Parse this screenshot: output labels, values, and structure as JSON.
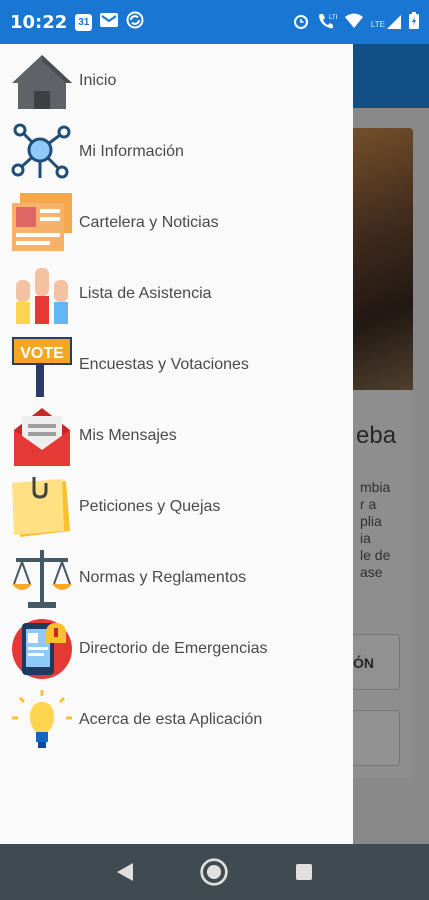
{
  "status_bar": {
    "time": "10:22",
    "left_icons": [
      "calendar-icon",
      "gmail-icon",
      "sync-icon"
    ],
    "right_icons": [
      "alarm-icon",
      "volte-call-icon",
      "wifi-icon",
      "lte-signal-icon",
      "battery-icon"
    ],
    "calendar_day": "31",
    "lte_label": "LTE"
  },
  "background": {
    "title_fragment": "eba",
    "body_fragment": "mbia\nr a\nplia\nia\nle de\nase",
    "button1_fragment": "ÓN",
    "button2_fragment": ""
  },
  "drawer": {
    "items": [
      {
        "label": "Inicio",
        "icon": "home-icon"
      },
      {
        "label": "Mi Información",
        "icon": "network-icon"
      },
      {
        "label": "Cartelera y Noticias",
        "icon": "news-board-icon"
      },
      {
        "label": "Lista de Asistencia",
        "icon": "raised-hands-icon"
      },
      {
        "label": "Encuestas y Votaciones",
        "icon": "vote-sign-icon"
      },
      {
        "label": "Mis Mensajes",
        "icon": "envelope-icon"
      },
      {
        "label": "Peticiones y Quejas",
        "icon": "sticky-note-icon"
      },
      {
        "label": "Normas y Reglamentos",
        "icon": "scales-icon"
      },
      {
        "label": "Directorio de Emergencias",
        "icon": "emergency-phone-icon"
      },
      {
        "label": "Acerca de esta Aplicación",
        "icon": "lightbulb-icon"
      }
    ],
    "vote_text": "VOTE"
  },
  "nav_bar": {
    "icons": [
      "back-icon",
      "home-button-icon",
      "recents-icon"
    ]
  }
}
